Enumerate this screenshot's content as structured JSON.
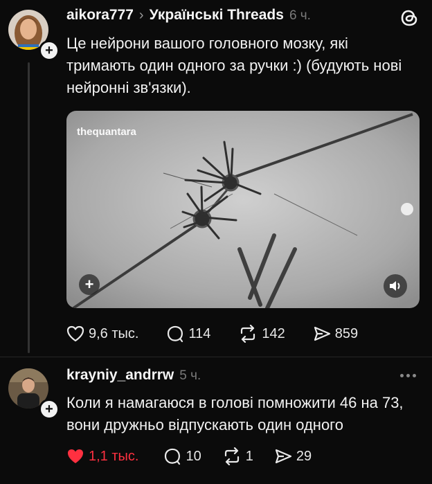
{
  "post": {
    "username": "aikora777",
    "community_separator": "›",
    "community": "Українські Threads",
    "time": "6 ч.",
    "text": "Це нейрони вашого головного  мозку, які тримають один одного за ручки :) (будують нові нейронні зв'язки).",
    "media_watermark": "thequantara",
    "stats": {
      "likes": "9,6 тыс.",
      "comments": "114",
      "reposts": "142",
      "shares": "859"
    }
  },
  "reply": {
    "username": "krayniy_andrrw",
    "time": "5 ч.",
    "text": "Коли я намагаюся в голові помножити 46 на 73, вони дружньо відпускають один одного",
    "stats": {
      "likes": "1,1 тыс.",
      "comments": "10",
      "reposts": "1",
      "shares": "29"
    }
  },
  "colors": {
    "background": "#0b0b0b",
    "liked_red": "#ff3040",
    "muted": "#7a7a7a"
  },
  "icons": [
    "threads-logo-icon",
    "heart-icon",
    "comment-icon",
    "repost-icon",
    "share-icon",
    "more-icon",
    "volume-icon",
    "plus-icon"
  ]
}
